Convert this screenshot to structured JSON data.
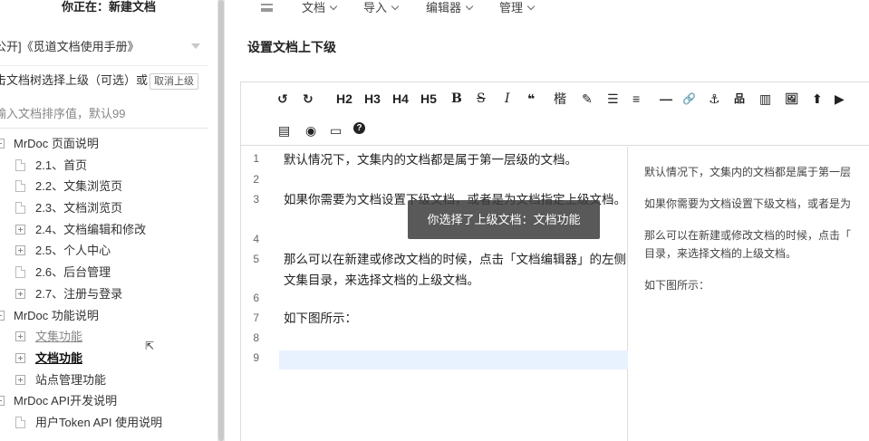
{
  "sidebar": {
    "title": "你正在：新建文档",
    "project": "公开]《觅道文档使用手册》",
    "parent_hint": "击文档树选择上级（可选）或",
    "cancel_parent_button": "取消上级",
    "sort_placeholder": "输入文档排序值，默认99",
    "tree": [
      {
        "label": "MrDoc 页面说明",
        "type": "folder",
        "level": 0
      },
      {
        "label": "2.1、首页",
        "type": "doc",
        "level": 1
      },
      {
        "label": "2.2、文集浏览页",
        "type": "doc",
        "level": 1
      },
      {
        "label": "2.3、文档浏览页",
        "type": "doc",
        "level": 1
      },
      {
        "label": "2.4、文档编辑和修改",
        "type": "folder",
        "level": 1
      },
      {
        "label": "2.5、个人中心",
        "type": "folder",
        "level": 1
      },
      {
        "label": "2.6、后台管理",
        "type": "doc",
        "level": 1
      },
      {
        "label": "2.7、注册与登录",
        "type": "folder",
        "level": 1
      },
      {
        "label": "MrDoc 功能说明",
        "type": "folder",
        "level": 0
      },
      {
        "label": "文集功能",
        "type": "folder",
        "level": 1,
        "style": "grey"
      },
      {
        "label": "文档功能",
        "type": "folder",
        "level": 1,
        "style": "bold"
      },
      {
        "label": "站点管理功能",
        "type": "folder",
        "level": 1
      },
      {
        "label": "MrDoc API开发说明",
        "type": "folder",
        "level": 0
      },
      {
        "label": "用户Token API 使用说明",
        "type": "doc",
        "level": 1
      }
    ]
  },
  "topnav": {
    "items": [
      "文档",
      "导入",
      "编辑器",
      "管理"
    ]
  },
  "section_title": "设置文档上下级",
  "toolbar": {
    "row1": [
      "↺",
      "↻",
      "H2",
      "H3",
      "H4",
      "H5",
      "B",
      "S",
      "I",
      "❝",
      "楷",
      "✎",
      "☰",
      "≡",
      "—",
      "🔗",
      "⚓",
      "品",
      "▥",
      "🖼",
      "⬆",
      "▶"
    ],
    "row2": [
      "▤",
      "◉",
      "▭",
      "?"
    ]
  },
  "editor": {
    "lines": [
      {
        "n": "1",
        "text": "默认情况下，文集内的文档都是属于第一层级的文档。"
      },
      {
        "n": "2",
        "text": ""
      },
      {
        "n": "3",
        "text": "如果你需要为文档设置下级文档，或者是为文档指定上级文档。"
      },
      {
        "n": "4",
        "text": ""
      },
      {
        "n": "5",
        "text": "那么可以在新建或修改文档的时候，点击「文档编辑器」的左侧文集目录，来选择文档的上级文档。"
      },
      {
        "n": "6",
        "text": ""
      },
      {
        "n": "7",
        "text": "如下图所示："
      },
      {
        "n": "8",
        "text": ""
      },
      {
        "n": "9",
        "text": ""
      }
    ]
  },
  "preview": {
    "p1": "默认情况下，文集内的文档都是属于第一层",
    "p2": "如果你需要为文档设置下级文档，或者是为",
    "p3a": "那么可以在新建或修改文档的时候，点击「",
    "p3b": "目录，来选择文档的上级文档。",
    "p4": "如下图所示："
  },
  "toast": "你选择了上级文档：文档功能"
}
